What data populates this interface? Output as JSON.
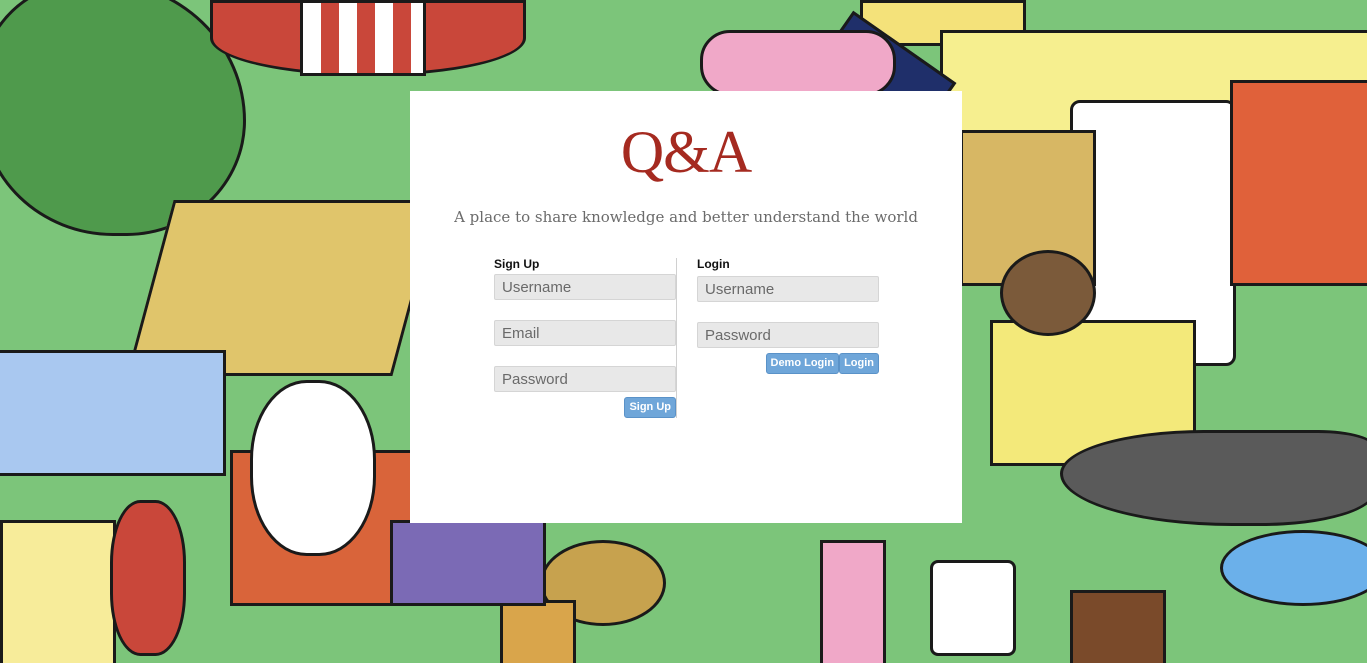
{
  "brand": {
    "logo": "Q&A",
    "tagline": "A place to share knowledge and better understand the world",
    "logo_color": "#a52a20"
  },
  "signup": {
    "title": "Sign Up",
    "username_placeholder": "Username",
    "email_placeholder": "Email",
    "password_placeholder": "Password",
    "submit_label": "Sign Up"
  },
  "login": {
    "title": "Login",
    "username_placeholder": "Username",
    "password_placeholder": "Password",
    "demo_label": "Demo Login",
    "submit_label": "Login"
  },
  "colors": {
    "button_bg": "#6fa6d9",
    "card_bg": "#ffffff"
  }
}
